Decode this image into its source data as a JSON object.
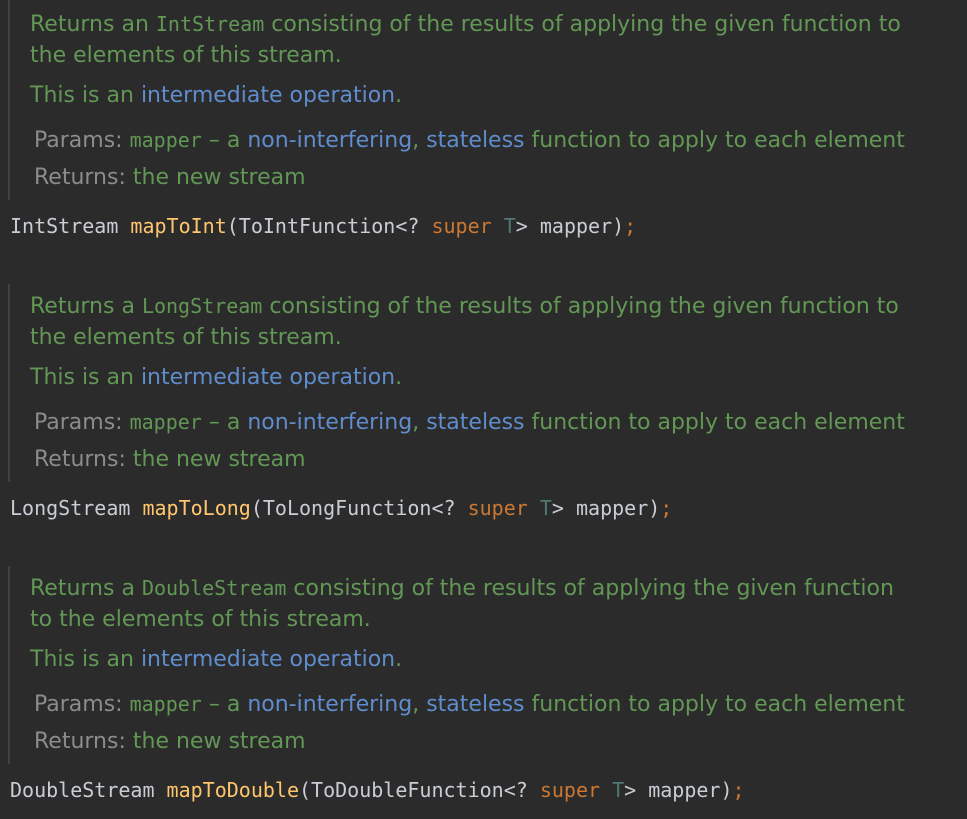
{
  "blocks": [
    {
      "returns_prefix": "Returns an ",
      "stream_type": "IntStream",
      "desc_tail_1": " consisting of the results of applying the given function to",
      "desc_line_2": "the elements of this stream.",
      "intermediate_prefix": "This is an ",
      "intermediate_link": "intermediate operation",
      "intermediate_suffix": ".",
      "params_label": "Params:",
      "param_name": "mapper",
      "param_dash": " – a ",
      "param_link1": "non-interfering",
      "param_comma": ", ",
      "param_link2": "stateless",
      "param_tail": " function to apply to each element",
      "returns_label": "Returns:",
      "returns_value": "the new stream",
      "code_return_type": "IntStream",
      "code_method": "mapToInt",
      "code_param_type": "ToIntFunction",
      "code_wild": "<? ",
      "code_super": "super",
      "code_t": "T",
      "code_close": "> mapper)",
      "code_semi": ";"
    },
    {
      "returns_prefix": "Returns a ",
      "stream_type": "LongStream",
      "desc_tail_1": " consisting of the results of applying the given function to",
      "desc_line_2": "the elements of this stream.",
      "intermediate_prefix": "This is an ",
      "intermediate_link": "intermediate operation",
      "intermediate_suffix": ".",
      "params_label": "Params:",
      "param_name": "mapper",
      "param_dash": " – a ",
      "param_link1": "non-interfering",
      "param_comma": ", ",
      "param_link2": "stateless",
      "param_tail": " function to apply to each element",
      "returns_label": "Returns:",
      "returns_value": "the new stream",
      "code_return_type": "LongStream",
      "code_method": "mapToLong",
      "code_param_type": "ToLongFunction",
      "code_wild": "<? ",
      "code_super": "super",
      "code_t": "T",
      "code_close": "> mapper)",
      "code_semi": ";"
    },
    {
      "returns_prefix": "Returns a ",
      "stream_type": "DoubleStream",
      "desc_tail_1": " consisting of the results of applying the given function",
      "desc_line_2": "to the elements of this stream.",
      "intermediate_prefix": "This is an ",
      "intermediate_link": "intermediate operation",
      "intermediate_suffix": ".",
      "params_label": "Params:",
      "param_name": "mapper",
      "param_dash": " – a ",
      "param_link1": "non-interfering",
      "param_comma": ", ",
      "param_link2": "stateless",
      "param_tail": " function to apply to each element",
      "returns_label": "Returns:",
      "returns_value": "the new stream",
      "code_return_type": "DoubleStream",
      "code_method": "mapToDouble",
      "code_param_type": "ToDoubleFunction",
      "code_wild": "<? ",
      "code_super": "super",
      "code_t": "T",
      "code_close": "> mapper)",
      "code_semi": ";"
    }
  ]
}
